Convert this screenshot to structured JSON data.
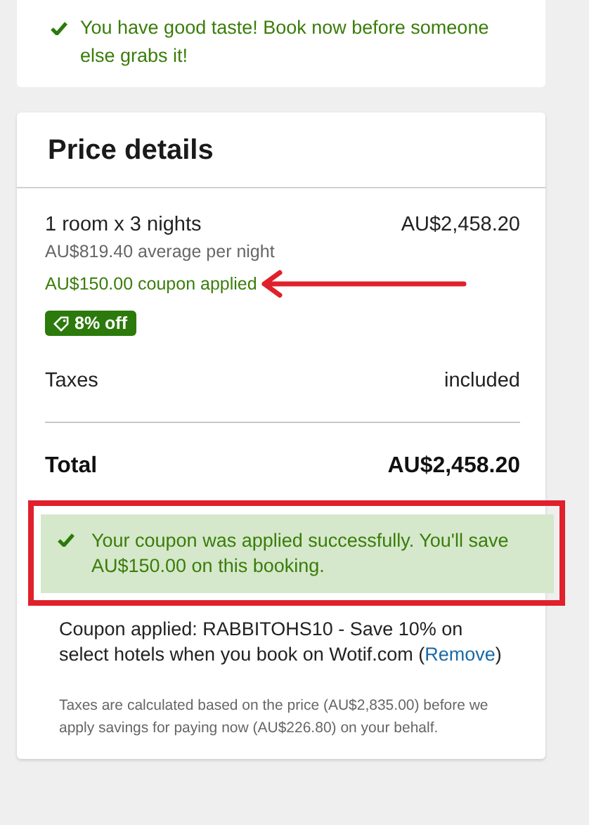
{
  "banner": {
    "message": "You have good taste! Book now before someone else grabs it!"
  },
  "price_details": {
    "title": "Price details",
    "room_line": {
      "label": "1 room x 3 nights",
      "amount": "AU$2,458.20"
    },
    "average": "AU$819.40 average per night",
    "coupon_note": "AU$150.00 coupon applied",
    "discount_badge": "8% off",
    "taxes": {
      "label": "Taxes",
      "value": "included"
    },
    "total": {
      "label": "Total",
      "amount": "AU$2,458.20"
    },
    "success_message": "Your coupon was applied successfully. You'll save AU$150.00 on this booking.",
    "coupon_info": {
      "text_before": "Coupon applied: RABBITOHS10 - Save 10% on select hotels when you book on Wotif.com (",
      "link": "Remove",
      "text_after": ")"
    },
    "footnote": "Taxes are calculated based on the price (AU$2,835.00) before we apply savings for paying now (AU$226.80) on your behalf."
  }
}
